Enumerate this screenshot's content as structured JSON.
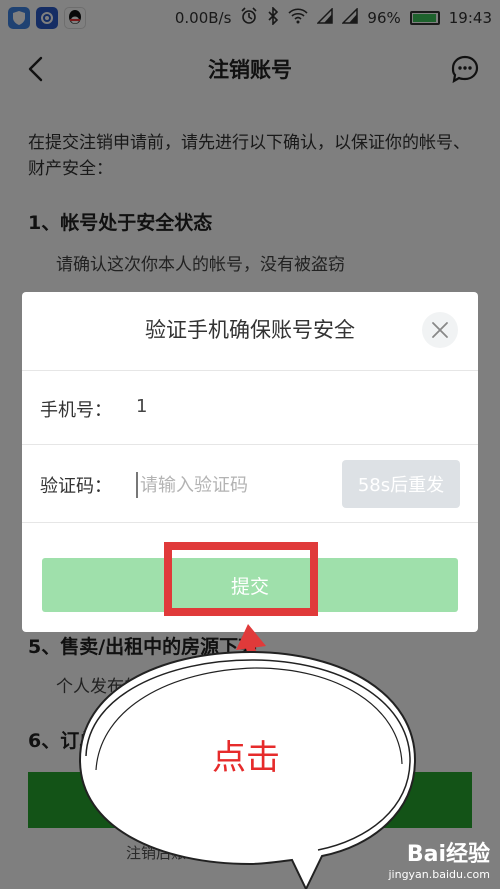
{
  "status_bar": {
    "network_speed": "0.00B/s",
    "battery_percent": "96%",
    "time": "19:43",
    "battery_level": 0.96,
    "icons": [
      "shield-app-icon",
      "security-app-icon",
      "qq-app-icon",
      "alarm-icon",
      "bluetooth-icon",
      "wifi-icon",
      "signal-icon",
      "signal-icon",
      "battery-icon"
    ]
  },
  "header": {
    "title": "注销账号",
    "back_icon": "chevron-left-icon",
    "more_icon": "chat-more-icon"
  },
  "page": {
    "intro": "在提交注销申请前，请先进行以下确认，以保证你的帐号、财产安全：",
    "sections": [
      {
        "heading": "1、帐号处于安全状态",
        "desc": "请确认这次你本人的帐号，没有被盗窃"
      },
      {
        "heading": "5、售卖/出租中的房源下架",
        "desc": "个人发布的售卖/出租中的房源会被下架"
      },
      {
        "heading": "6、订单"
      }
    ],
    "footer_note": "注销后账号不可以进行操作"
  },
  "dialog": {
    "title": "验证手机确保账号安全",
    "phone_label": "手机号：",
    "phone_value": "1",
    "code_label": "验证码：",
    "code_placeholder": "请输入验证码",
    "resend_label": "58s后重发",
    "submit_label": "提交",
    "accent_color": "#9fe0ab"
  },
  "annotation": {
    "label": "点击",
    "color": "#e62b2b"
  },
  "watermark": {
    "main": "Bai经验",
    "sub": "jingyan.baidu.com"
  }
}
